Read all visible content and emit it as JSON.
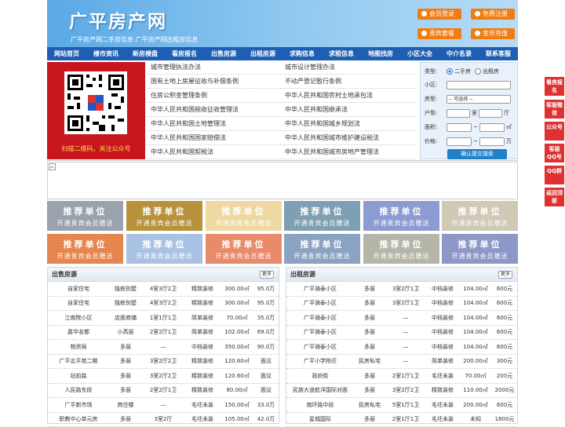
{
  "header": {
    "logo": "广平房产网",
    "slogan": "广平房产网二手房信息   广平房产网出租房信息",
    "buttons": [
      "会员登录",
      "免费注册",
      "贵宾套餐",
      "金币充值"
    ]
  },
  "nav": [
    "网站首页",
    "楼市资讯",
    "新房楼盘",
    "看房报名",
    "出售房源",
    "出租房源",
    "求购信息",
    "求租信息",
    "地图找房",
    "小区大全",
    "中介名录",
    "联系客服"
  ],
  "qr": {
    "caption": "扫描二维码，关注公众号"
  },
  "links": [
    [
      "城市管理执法办法",
      "城市设计管理办法"
    ],
    [
      "国有土地上房屋征收与补偿条例",
      "不动产登记暂行条例"
    ],
    [
      "住房公积金管理条例",
      "中华人民共和国农村土地承包法"
    ],
    [
      "中华人民共和国税收征收管理法",
      "中华人民共和国继承法"
    ],
    [
      "中华人民共和国土地管理法",
      "中华人民共和国城乡规划法"
    ],
    [
      "中华人民共和国国家赔偿法",
      "中华人民共和国城市维护建设税法"
    ],
    [
      "中华人民共和国契税法",
      "中华人民共和国城市房地产管理法"
    ]
  ],
  "search": {
    "type_label": "类型:",
    "opt1": "二手房",
    "opt2": "出租房",
    "community_label": "小区:",
    "room_label": "房型:",
    "room_select": "-- 可选择 --",
    "layout_label": "户型:",
    "shi": "室",
    "ting": "厅",
    "area_label": "面积:",
    "sqm": "㎡",
    "price_label": "价格:",
    "wan": "万",
    "tilde": "~",
    "submit": "确认提交搜索"
  },
  "ads": {
    "title": "推荐单位",
    "sub": "开通贵宾会员赠送",
    "colors": [
      "#9aa3ad",
      "#b8913c",
      "#efd9a2",
      "#7fa0b3",
      "#8c9bd1",
      "#cfc9b6",
      "#e6864f",
      "#a9c2e3",
      "#e98a6a",
      "#8ba3c2",
      "#b6b6a8",
      "#8e98c8"
    ]
  },
  "sale": {
    "title": "出售房源",
    "more": "更多",
    "rows": [
      [
        "自家住宅",
        "独栋别墅",
        "4室3厅2卫",
        "精致装修",
        "300.00㎡",
        "95.0万"
      ],
      [
        "自家住宅",
        "独栋别墅",
        "4室3厅2卫",
        "精致装修",
        "300.00㎡",
        "95.0万"
      ],
      [
        "江南院小区",
        "店面商铺",
        "1室1厅1卫",
        "简单装修",
        "70.00㎡",
        "35.0万"
      ],
      [
        "嘉华名都",
        "小高层",
        "2室2厅1卫",
        "简单装修",
        "102.00㎡",
        "69.0万"
      ],
      [
        "物资局",
        "多层",
        "—",
        "中档装修",
        "350.00㎡",
        "90.0万"
      ],
      [
        "广平北平苑二期",
        "多层",
        "3室2厅2卫",
        "精致装修",
        "120.60㎡",
        "面议"
      ],
      [
        "站前路",
        "多层",
        "3室2厅2卫",
        "精致装修",
        "120.60㎡",
        "面议"
      ],
      [
        "人民路东段",
        "多层",
        "2室2厅1卫",
        "精致装修",
        "80.00㎡",
        "面议"
      ],
      [
        "广平新市场",
        "商住楼",
        "—",
        "毛坯未装",
        "150.00㎡",
        "33.0万"
      ],
      [
        "职教中心单元房",
        "多层",
        "3室2厅",
        "毛坯未装",
        "105.00㎡",
        "42.0万"
      ]
    ]
  },
  "rent": {
    "title": "出租房源",
    "more": "更多",
    "rows": [
      [
        "广平骑泰小区",
        "多层",
        "3室2厅1卫",
        "中档装修",
        "104.00㎡",
        "600元"
      ],
      [
        "广平骑泰小区",
        "多层",
        "3室2厅1卫",
        "中档装修",
        "104.00㎡",
        "600元"
      ],
      [
        "广平骑泰小区",
        "多层",
        "—",
        "中档装修",
        "104.00㎡",
        "600元"
      ],
      [
        "广平骑泰小区",
        "多层",
        "—",
        "中档装修",
        "104.00㎡",
        "600元"
      ],
      [
        "广平骑泰小区",
        "多层",
        "—",
        "中档装修",
        "104.00㎡",
        "600元"
      ],
      [
        "广平小学附近",
        "民房私宅",
        "—",
        "简单装修",
        "200.00㎡",
        "300元"
      ],
      [
        "政府街",
        "多层",
        "2室1厅1卫",
        "毛坯未装",
        "70.00㎡",
        "200元"
      ],
      [
        "民族大道航洋国际对面",
        "多层",
        "3室2厅2卫",
        "精致装修",
        "110.00㎡",
        "2000元"
      ],
      [
        "南环路中段",
        "民房私宅",
        "5室1厅1卫",
        "毛坯未装",
        "200.00㎡",
        "600元"
      ],
      [
        "星城国际",
        "多层",
        "2室1厅1卫",
        "毛坯未装",
        "未知",
        "1800元"
      ]
    ]
  },
  "side": [
    "看房报名",
    "客服微信",
    "公众号",
    "客服QQ号",
    "QQ群",
    "返回顶部"
  ]
}
